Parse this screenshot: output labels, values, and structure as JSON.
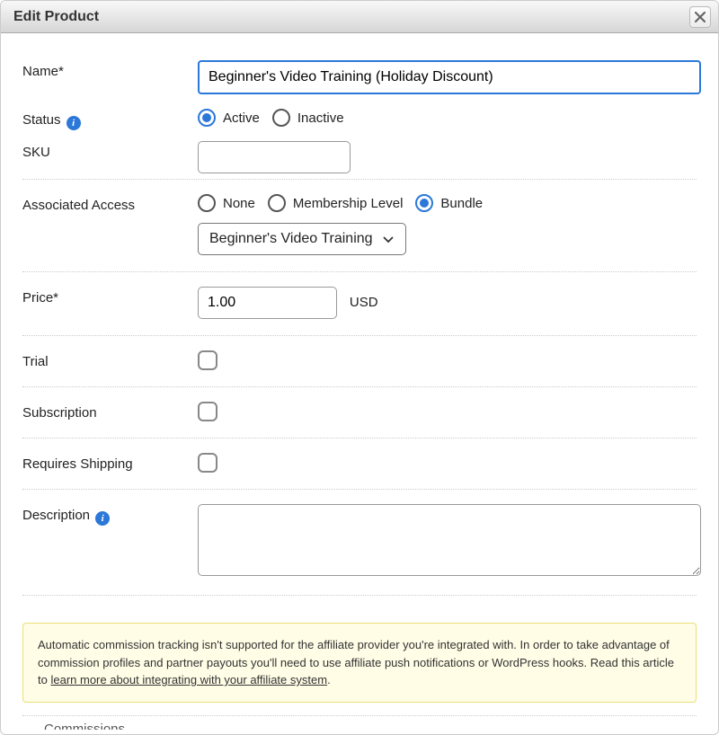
{
  "dialog": {
    "title": "Edit Product"
  },
  "form": {
    "name_label": "Name*",
    "name_value": "Beginner's Video Training (Holiday Discount)",
    "status_label": "Status",
    "status_options": {
      "active": "Active",
      "inactive": "Inactive"
    },
    "status_selected": "active",
    "sku_label": "SKU",
    "sku_value": "",
    "access_label": "Associated Access",
    "access_options": {
      "none": "None",
      "membership": "Membership Level",
      "bundle": "Bundle"
    },
    "access_selected": "bundle",
    "access_bundle_value": "Beginner's Video Training",
    "price_label": "Price*",
    "price_value": "1.00",
    "price_currency": "USD",
    "trial_label": "Trial",
    "trial_checked": false,
    "subscription_label": "Subscription",
    "subscription_checked": false,
    "shipping_label": "Requires Shipping",
    "shipping_checked": false,
    "description_label": "Description",
    "description_value": ""
  },
  "notice": {
    "text_before": "Automatic commission tracking isn't supported for the affiliate provider you're integrated with. In order to take advantage of commission profiles and partner payouts you'll need to use affiliate push notifications or WordPress hooks. Read this article to ",
    "link_text": "learn more about integrating with your affiliate system",
    "text_after": "."
  },
  "cutoff_label": "Commissions"
}
